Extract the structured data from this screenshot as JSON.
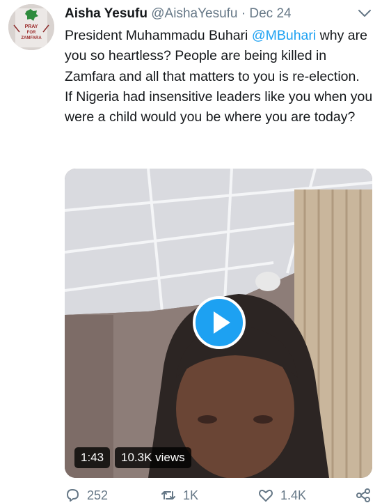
{
  "tweet": {
    "author_name": "Aisha Yesufu",
    "author_handle": "@AishaYesufu",
    "separator": "·",
    "date": "Dec 24",
    "avatar_text": [
      "PRAY",
      "FOR",
      "ZAMFARA"
    ],
    "text_part1": "President Muhammadu Buhari ",
    "mention": "@MBuhari",
    "text_part2": " why are you so heartless? People are being killed in Zamfara and all that matters to you is re-election.",
    "text_para2": "If Nigeria had insensitive leaders like you when you were a child would you be where you are today?"
  },
  "video": {
    "duration": "1:43",
    "views": "10.3K views"
  },
  "actions": {
    "replies": "252",
    "retweets": "1K",
    "likes": "1.4K"
  },
  "colors": {
    "accent": "#1da1f2",
    "muted": "#657786",
    "text": "#14171a"
  },
  "icons": [
    "chevron-down-icon",
    "play-icon",
    "reply-icon",
    "retweet-icon",
    "like-icon",
    "share-icon"
  ]
}
